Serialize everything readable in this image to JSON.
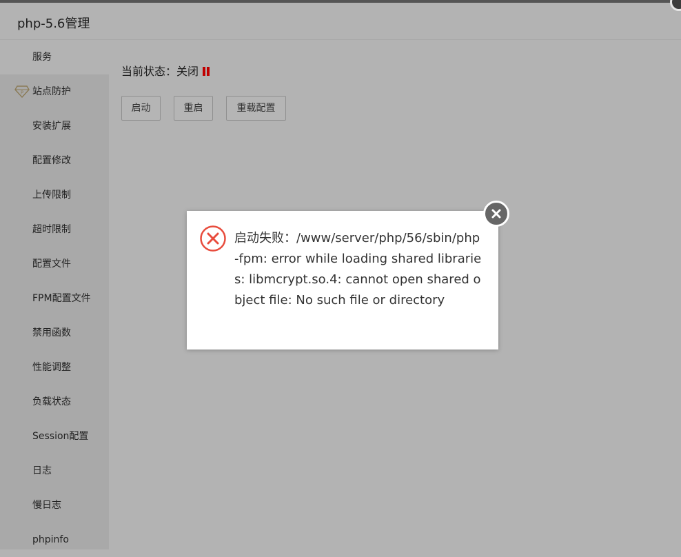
{
  "window": {
    "title": "php-5.6管理"
  },
  "sidebar": {
    "items": [
      {
        "label": "服务",
        "active": true
      },
      {
        "label": "站点防护",
        "icon": "diamond-icon"
      },
      {
        "label": "安装扩展"
      },
      {
        "label": "配置修改"
      },
      {
        "label": "上传限制"
      },
      {
        "label": "超时限制"
      },
      {
        "label": "配置文件"
      },
      {
        "label": "FPM配置文件"
      },
      {
        "label": "禁用函数"
      },
      {
        "label": "性能调整"
      },
      {
        "label": "负载状态"
      },
      {
        "label": "Session配置"
      },
      {
        "label": "日志"
      },
      {
        "label": "慢日志"
      },
      {
        "label": "phpinfo"
      }
    ]
  },
  "service": {
    "status_text": "当前状态：关闭",
    "status_icon": "pause-icon",
    "status_color": "#c00000",
    "buttons": {
      "start": "启动",
      "restart": "重启",
      "reload": "重载配置"
    }
  },
  "dialog": {
    "icon": "error-icon",
    "icon_color": "#e84c3d",
    "message": "启动失败：/www/server/php/56/sbin/php-fpm: error while loading shared libraries: libmcrypt.so.4: cannot open shared object file: No such file or directory"
  }
}
